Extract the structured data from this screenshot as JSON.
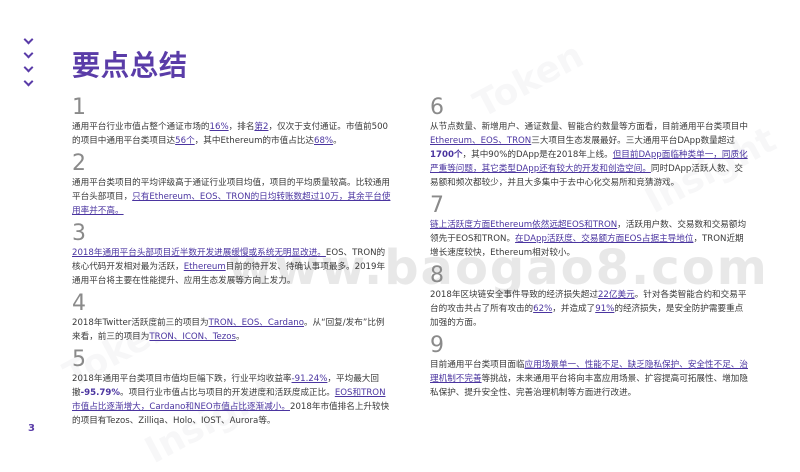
{
  "slide": {
    "title": "要点总结",
    "page_number": "3",
    "watermarks": [
      "Token",
      "Insight",
      "Token",
      "Insight"
    ],
    "center_watermark": "www.baogao8.com"
  },
  "left_items": [
    {
      "num": "1",
      "segments": [
        {
          "t": "通用平台行业市值占整个通证市场的",
          "s": "n"
        },
        {
          "t": "16%",
          "s": "ul"
        },
        {
          "t": "，排名",
          "s": "n"
        },
        {
          "t": "第2",
          "s": "ul"
        },
        {
          "t": "，仅次于支付通证。市值前500的项目中通用平台类项目达",
          "s": "n"
        },
        {
          "t": "56个",
          "s": "ul"
        },
        {
          "t": "，其中Ethereum的市值占比达",
          "s": "n"
        },
        {
          "t": "68%",
          "s": "ul"
        },
        {
          "t": "。",
          "s": "n"
        }
      ]
    },
    {
      "num": "2",
      "segments": [
        {
          "t": "通用平台类项目的平均评级高于通证行业项目均值，项目的平均质量较高。比较通用平台头部项目，",
          "s": "n"
        },
        {
          "t": "只有Ethereum、EOS、TRON的日均转账数超过10万，其余平台使用率并不高。",
          "s": "ul"
        }
      ]
    },
    {
      "num": "3",
      "segments": [
        {
          "t": "2018年通用平台头部项目近半数开发进展缓慢或系统无明显改进。",
          "s": "ul"
        },
        {
          "t": "EOS、TRON的核心代码开发相对最为活跃，",
          "s": "n"
        },
        {
          "t": "Ethereum",
          "s": "ul"
        },
        {
          "t": "目前的待开发、待确认事项最多。2019年通用平台将主要在性能提升、应用生态发展等方向上发力。",
          "s": "n"
        }
      ]
    },
    {
      "num": "4",
      "segments": [
        {
          "t": "2018年Twitter活跃度前三的项目为",
          "s": "n"
        },
        {
          "t": "TRON、EOS、Cardano",
          "s": "ul"
        },
        {
          "t": "。从“回复/发布”比例来看，前三的项目为",
          "s": "n"
        },
        {
          "t": "TRON、ICON、Tezos",
          "s": "ul"
        },
        {
          "t": "。",
          "s": "n"
        }
      ]
    },
    {
      "num": "5",
      "segments": [
        {
          "t": "2018年通用平台类项目市值均巨幅下跌，行业平均收益率",
          "s": "n"
        },
        {
          "t": "-91.24%",
          "s": "ul"
        },
        {
          "t": "，平均最大回撤",
          "s": "n"
        },
        {
          "t": "-95.79%",
          "s": "bold"
        },
        {
          "t": "。项目行业市值占比与项目的开发进度和活跃度成正比。",
          "s": "n"
        },
        {
          "t": "EOS和TRON市值占比逐渐增大，Cardano和NEO市值占比逐渐减小。",
          "s": "ul"
        },
        {
          "t": "2018年市值排名上升较快的项目有Tezos、Zilliqa、Holo、IOST、Aurora等。",
          "s": "n"
        }
      ]
    }
  ],
  "right_items": [
    {
      "num": "6",
      "segments": [
        {
          "t": "从节点数量、新增用户、通证数量、智能合约数量等方面看，目前通用平台类项目中",
          "s": "n"
        },
        {
          "t": "Ethereum、EOS、TRON",
          "s": "ul"
        },
        {
          "t": "三大项目生态发展最好。三大通用平台DApp数量超过",
          "s": "n"
        },
        {
          "t": "1700个",
          "s": "bold"
        },
        {
          "t": "，其中90%的DApp是在2018年上线。",
          "s": "n"
        },
        {
          "t": "但目前DApp面临种类单一，同质化严重等问题，其它类型DApp还有较大的开发和创造空间。",
          "s": "ul"
        },
        {
          "t": "同时DApp活跃人数、交易额和频次都较少，并且大多集中于去中心化交易所和竞猜游戏。",
          "s": "n"
        }
      ]
    },
    {
      "num": "7",
      "segments": [
        {
          "t": "链上活跃度方面Ethereum依然远超EOS和TRON",
          "s": "ul"
        },
        {
          "t": "，活跃用户数、交易数和交易额均领先于EOS和TRON。",
          "s": "n"
        },
        {
          "t": "在DApp活跃度、交易额方面EOS占据主导地位",
          "s": "ul"
        },
        {
          "t": "，TRON近期增长速度较快，Ethereum相对较小。",
          "s": "n"
        }
      ]
    },
    {
      "num": "8",
      "segments": [
        {
          "t": "2018年区块链安全事件导致的经济损失超过",
          "s": "n"
        },
        {
          "t": "22亿美元",
          "s": "ul"
        },
        {
          "t": "。针对各类智能合约和交易平台的攻击共占了所有攻击的",
          "s": "n"
        },
        {
          "t": "62%",
          "s": "ul"
        },
        {
          "t": "，并造成了",
          "s": "n"
        },
        {
          "t": "91%",
          "s": "ul"
        },
        {
          "t": "的经济损失，是安全防护需要重点加强的方面。",
          "s": "n"
        }
      ]
    },
    {
      "num": "9",
      "segments": [
        {
          "t": "目前通用平台类项目面临",
          "s": "n"
        },
        {
          "t": "应用场景单一、性能不足、缺乏隐私保护、安全性不足、治理机制不完善",
          "s": "ul"
        },
        {
          "t": "等挑战，未来通用平台将向丰富应用场景、扩容提高可拓展性、增加隐私保护、提升安全性、完善治理机制等方面进行改进。",
          "s": "n"
        }
      ]
    }
  ]
}
